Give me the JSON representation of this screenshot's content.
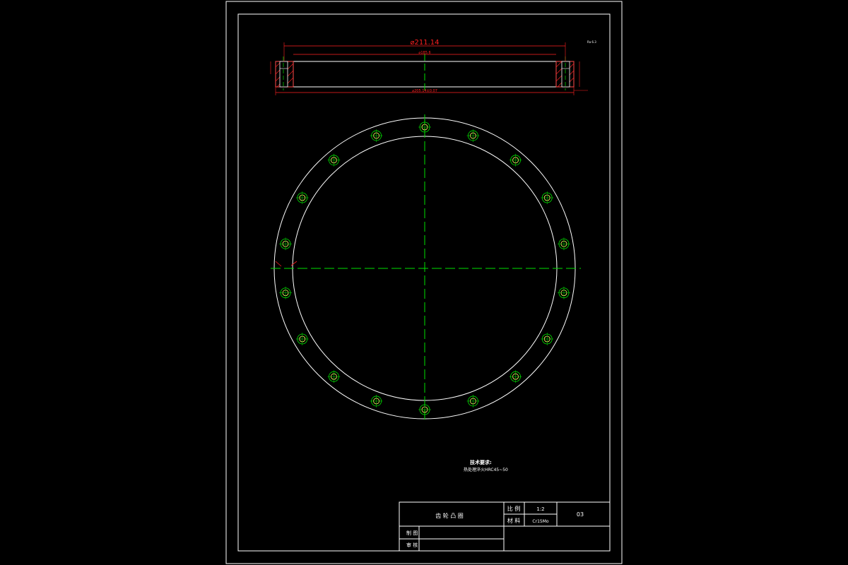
{
  "drawing": {
    "section_view": {
      "dim_outer_diameter": "⌀211.14",
      "dim_inner_diameter": "⌀185.6",
      "dim_bottom": "⌀205.14±0.07",
      "roughness_note": "Ra 6.3"
    },
    "plan_view": {
      "bolt_hole_count": 18
    },
    "technical_requirements": {
      "heading": "技术要求:",
      "line1": "热处理淬火HRC45~50"
    }
  },
  "title_block": {
    "part_name": "齿 轮 凸 圈",
    "scale_label": "比 例",
    "scale_value": "1:2",
    "drawing_number": "03",
    "material_label": "材 料",
    "material_value": "Cr15Mo",
    "drafter_label": "制 图",
    "checker_label": "审 核"
  },
  "colors": {
    "outline": "#ffffff",
    "dimension": "#ff2020",
    "centerline": "#00e000",
    "hole": "#ffff66"
  }
}
